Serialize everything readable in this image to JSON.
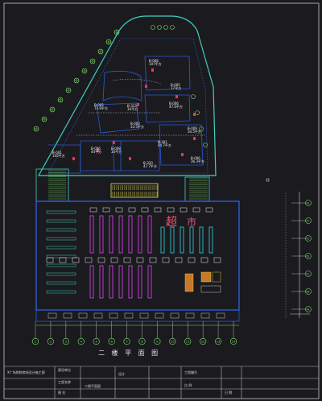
{
  "drawing": {
    "title": "二 楼 平 面 图",
    "supermarket_char_1": "超",
    "supermarket_char_2": "市",
    "shops": [
      {
        "code": "B-008",
        "area": "107平方"
      },
      {
        "code": "B-002",
        "area": "73.8平方"
      },
      {
        "code": "B-313",
        "area": "34平方"
      },
      {
        "code": "B-003",
        "area": "33.5平方"
      },
      {
        "code": "B-005",
        "area": "17平方"
      },
      {
        "code": "B-006",
        "area": "47.6平方"
      },
      {
        "code": "B-009",
        "area": "34.5平方"
      },
      {
        "code": "B-001",
        "area": "105平方"
      },
      {
        "code": "B-006",
        "area": "44平方"
      },
      {
        "code": "B-008",
        "area": "33平方"
      },
      {
        "code": "B-301",
        "area": "44.7平方"
      },
      {
        "code": "B-310",
        "area": "47.7平方"
      },
      {
        "code": "B-006",
        "area": "36.3平方"
      }
    ],
    "axis_bottom": [
      "1",
      "2",
      "3",
      "4",
      "5",
      "6",
      "7",
      "8",
      "9",
      "10",
      "11",
      "12",
      "13",
      "14"
    ],
    "axis_right": [
      "G",
      "F",
      "E",
      "D",
      "C",
      "B",
      "A"
    ]
  },
  "title_block": {
    "project": "X广场购物商场设计施工图",
    "owner_label": "建设单位",
    "project_label": "工程名称",
    "drawing_name_label": "图 名",
    "drawing_name": "二楼平面图",
    "designer_label": "设计",
    "drawing_no_label": "工程编号",
    "scale_label": "比 例",
    "date_label": "日 期"
  },
  "colors": {
    "background": "#1b1b1f",
    "outline": "#3fd0c0",
    "tree": "#7ee06a",
    "shelf_magenta": "#d040e0",
    "shelf_cyan": "#30c0c8",
    "wall_blue": "#2a5bd7",
    "accent_red": "#ff4d6d",
    "yellow": "#e6e04a",
    "white": "#f2f2f2"
  }
}
